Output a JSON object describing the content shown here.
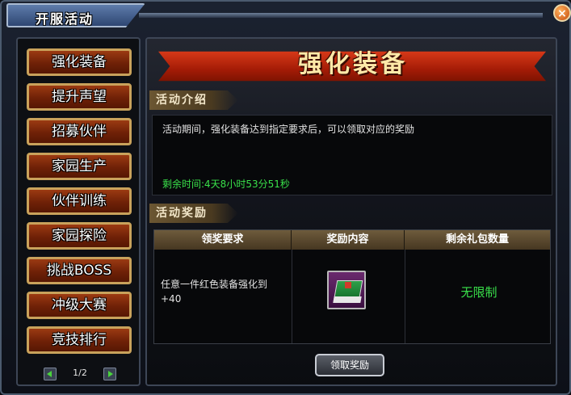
{
  "window": {
    "title": "开服活动",
    "close_label": "×"
  },
  "sidebar": {
    "items": [
      {
        "label": "强化装备"
      },
      {
        "label": "提升声望"
      },
      {
        "label": "招募伙伴"
      },
      {
        "label": "家园生产"
      },
      {
        "label": "伙伴训练"
      },
      {
        "label": "家园探险"
      },
      {
        "label": "挑战BOSS"
      },
      {
        "label": "冲级大赛"
      },
      {
        "label": "竞技排行"
      }
    ],
    "pager": {
      "text": "1/2"
    }
  },
  "main": {
    "banner_title": "强化装备",
    "intro": {
      "heading": "活动介绍",
      "description": "活动期间，强化装备达到指定要求后，可以领取对应的奖励",
      "remaining": "剩余时间:4天8小时53分51秒"
    },
    "rewards": {
      "heading": "活动奖励",
      "columns": [
        "领奖要求",
        "奖励内容",
        "剩余礼包数量"
      ],
      "rows": [
        {
          "requirement": "任意一件红色装备强化到+40",
          "reward_icon": "green-book-icon",
          "remaining": "无限制"
        }
      ]
    },
    "claim_button": "领取奖励"
  },
  "colors": {
    "accent_red": "#a21b06",
    "green_text": "#39e04a",
    "gold_border": "#c9a25b"
  }
}
